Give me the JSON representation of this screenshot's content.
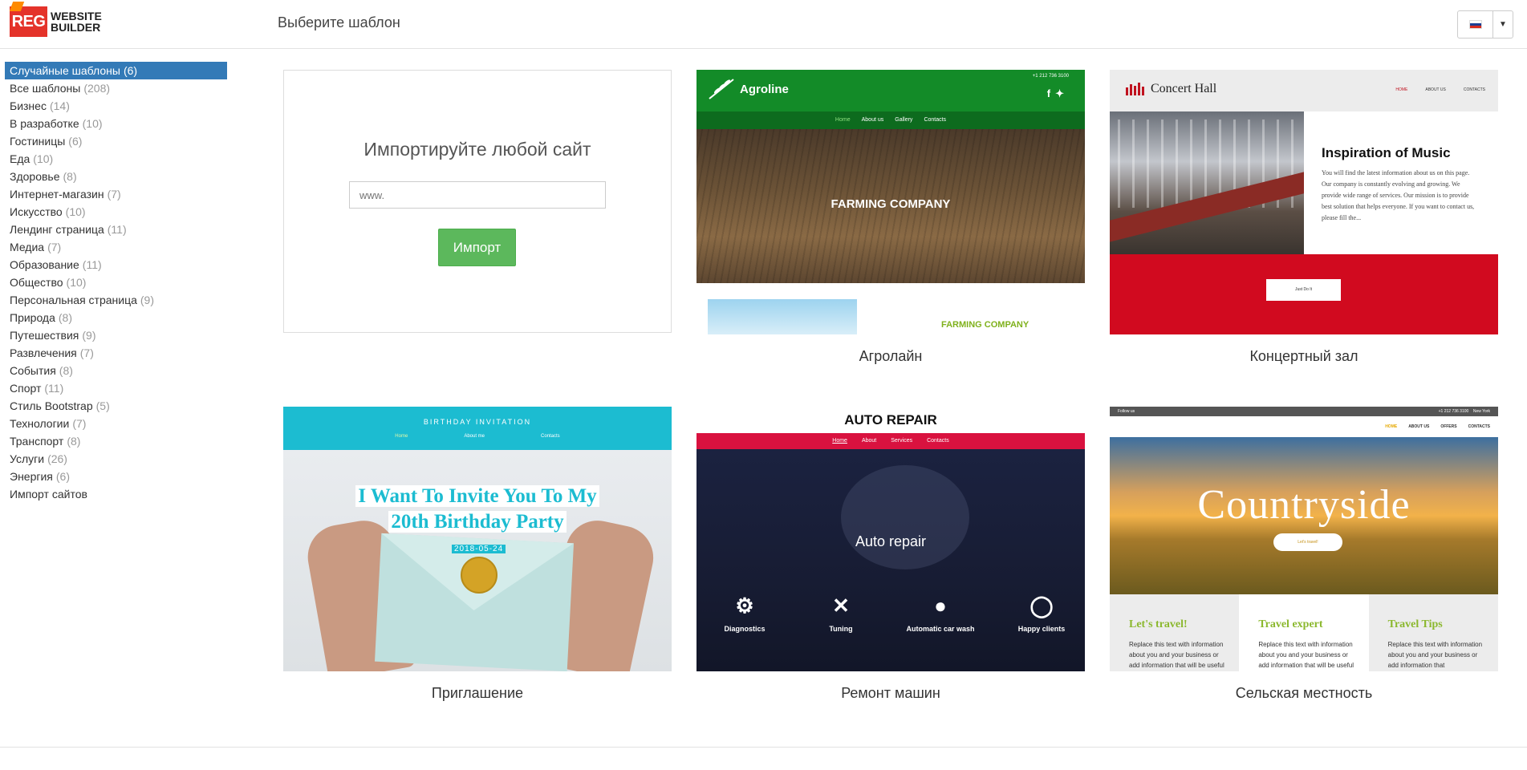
{
  "header": {
    "logo_badge": "REG",
    "logo_line1": "WEBSITE",
    "logo_line2": "BUILDER",
    "title": "Выберите шаблон",
    "language_flag": "flag-ru-icon"
  },
  "sidebar": {
    "items": [
      {
        "label": "Случайные шаблоны",
        "count": "(6)",
        "active": true
      },
      {
        "label": "Все шаблоны",
        "count": "(208)"
      },
      {
        "label": "Бизнес",
        "count": "(14)"
      },
      {
        "label": "В разработке",
        "count": "(10)"
      },
      {
        "label": "Гостиницы",
        "count": "(6)"
      },
      {
        "label": "Еда",
        "count": "(10)"
      },
      {
        "label": "Здоровье",
        "count": "(8)"
      },
      {
        "label": "Интернет-магазин",
        "count": "(7)"
      },
      {
        "label": "Искусство",
        "count": "(10)"
      },
      {
        "label": "Лендинг страница",
        "count": "(11)"
      },
      {
        "label": "Медиа",
        "count": "(7)"
      },
      {
        "label": "Образование",
        "count": "(11)"
      },
      {
        "label": "Общество",
        "count": "(10)"
      },
      {
        "label": "Персональная страница",
        "count": "(9)"
      },
      {
        "label": "Природа",
        "count": "(8)"
      },
      {
        "label": "Путешествия",
        "count": "(9)"
      },
      {
        "label": "Развлечения",
        "count": "(7)"
      },
      {
        "label": "События",
        "count": "(8)"
      },
      {
        "label": "Спорт",
        "count": "(11)"
      },
      {
        "label": "Стиль Bootstrap",
        "count": "(5)"
      },
      {
        "label": "Технологии",
        "count": "(7)"
      },
      {
        "label": "Транспорт",
        "count": "(8)"
      },
      {
        "label": "Услуги",
        "count": "(26)"
      },
      {
        "label": "Энергия",
        "count": "(6)"
      },
      {
        "label": "Импорт сайтов",
        "count": ""
      }
    ]
  },
  "import": {
    "title": "Импортируйте любой сайт",
    "placeholder": "www.",
    "button": "Импорт"
  },
  "templates": {
    "agroline": {
      "caption": "Агролайн",
      "logo": "Agroline",
      "phone": "+1 212 736 3100",
      "nav": [
        "Home",
        "About us",
        "Gallery",
        "Contacts"
      ],
      "hero": "FARMING COMPANY",
      "bottom_text": "FARMING COMPANY"
    },
    "concert": {
      "caption": "Концертный зал",
      "logo": "Concert Hall",
      "nav": [
        "HOME",
        "ABOUT US",
        "CONTACTS"
      ],
      "heading": "Inspiration of Music",
      "body": "You will find the latest information about us on this page. Our company is constantly evolving and growing. We provide wide range of services. Our mission is to provide best solution that helps everyone. If you want to contact us, please fill the...",
      "button": "Just Do It"
    },
    "invitation": {
      "caption": "Приглашение",
      "title": "BIRTHDAY INVITATION",
      "nav": [
        "Home",
        "About me",
        "Contacts"
      ],
      "headline1": "I Want To Invite You To My",
      "headline2": "20th Birthday Party",
      "date": "2018-05-24"
    },
    "autorepair": {
      "caption": "Ремонт машин",
      "logo": "AUTO REPAIR",
      "nav": [
        "Home",
        "About",
        "Services",
        "Contacts"
      ],
      "hero": "Auto repair",
      "services": [
        {
          "label": "Diagnostics",
          "icon": "gears-icon"
        },
        {
          "label": "Tuning",
          "icon": "wrench-icon"
        },
        {
          "label": "Automatic car wash",
          "icon": "drop-icon"
        },
        {
          "label": "Happy clients",
          "icon": "smile-icon"
        }
      ]
    },
    "countryside": {
      "caption": "Сельская местность",
      "topbar_left": "Follow us",
      "topbar_phone": "+1 212 736 3100",
      "topbar_city": "New York",
      "nav": [
        "HOME",
        "ABOUT US",
        "OFFERS",
        "CONTACTS"
      ],
      "hero": "Countryside",
      "button": "Let's travel!",
      "columns": [
        {
          "title": "Let's travel!",
          "text": "Replace this text with information about you and your business or add information that will be useful for"
        },
        {
          "title": "Travel expert",
          "text": "Replace this text with information about you and your business or add information that will be useful"
        },
        {
          "title": "Travel Tips",
          "text": "Replace this text with information about you and your business or add information that"
        }
      ]
    }
  },
  "colors": {
    "active_category": "#337ab7",
    "import_button": "#5cb85c",
    "brand_red": "#e4332a"
  }
}
